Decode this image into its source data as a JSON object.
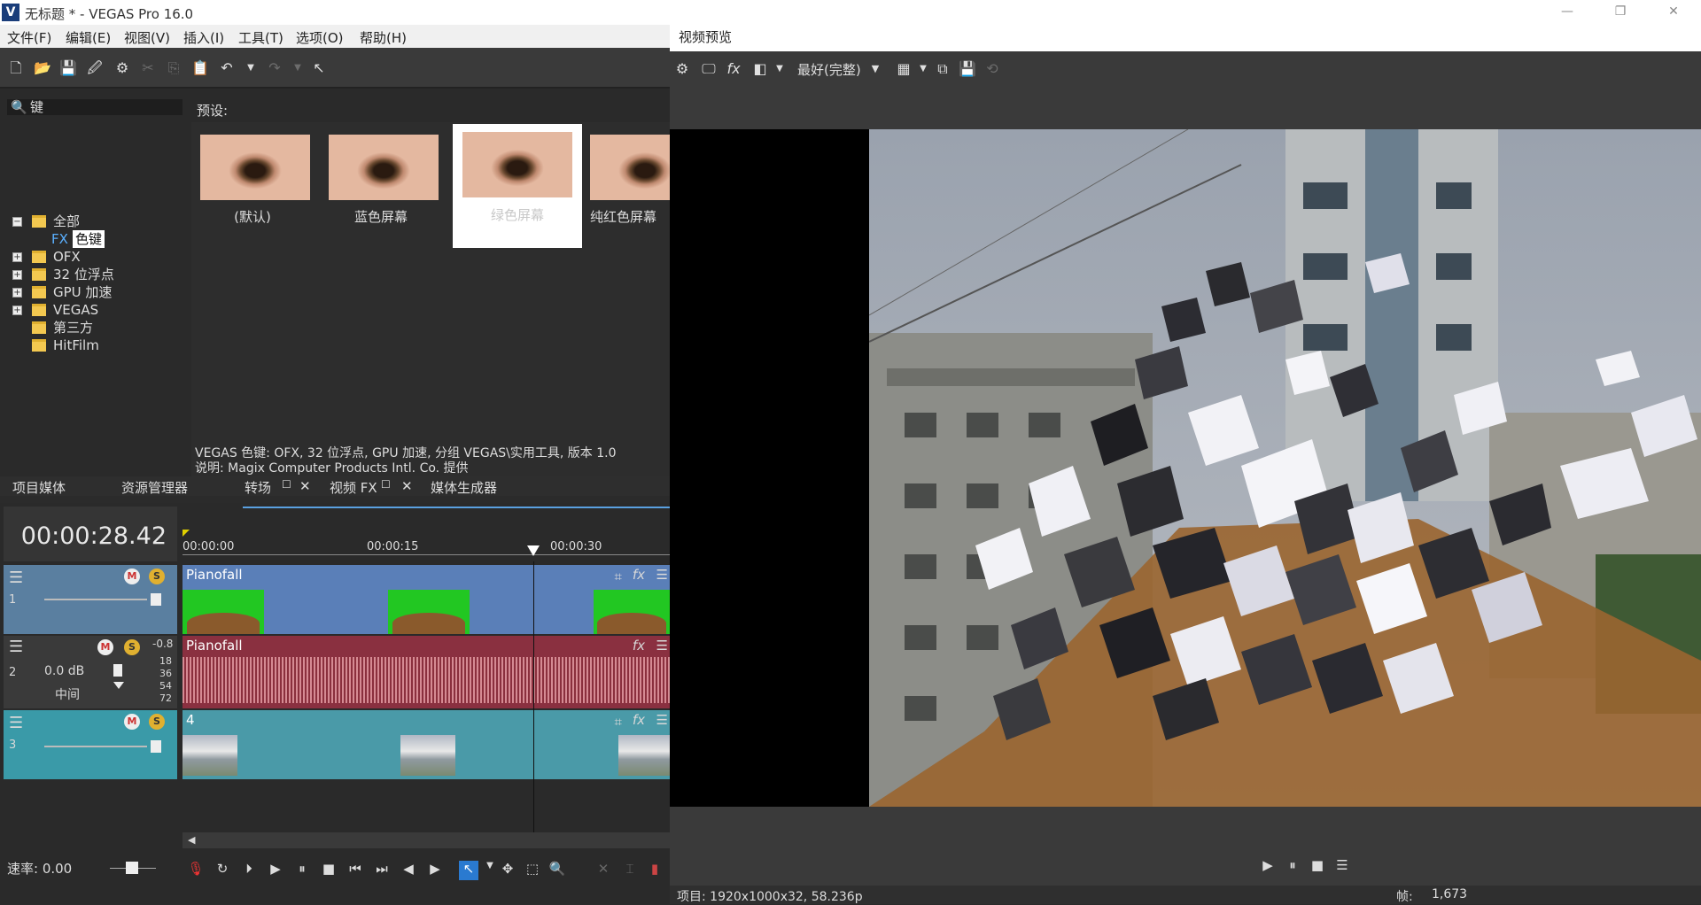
{
  "window": {
    "title": "无标题 * - VEGAS Pro 16.0",
    "controls": [
      "—",
      "❐",
      "✕"
    ]
  },
  "menu": [
    "文件(F)",
    "编辑(E)",
    "视图(V)",
    "插入(I)",
    "工具(T)",
    "选项(O)",
    "帮助(H)"
  ],
  "explorer": {
    "search_value": "键",
    "tree": [
      {
        "label": "全部",
        "expanded": true
      },
      {
        "label": "色键",
        "prefix": "FX",
        "selected": true
      },
      {
        "label": "OFX"
      },
      {
        "label": "32 位浮点"
      },
      {
        "label": "GPU 加速"
      },
      {
        "label": "VEGAS"
      },
      {
        "label": "第三方"
      },
      {
        "label": "HitFilm"
      }
    ],
    "presets_label": "预设:",
    "presets": [
      "(默认)",
      "蓝色屏幕",
      "绿色屏幕",
      "纯红色屏幕"
    ],
    "description_line1": "VEGAS 色键: OFX, 32 位浮点, GPU 加速, 分组 VEGAS\\实用工具, 版本 1.0",
    "description_line2": "说明: Magix Computer Products Intl. Co. 提供"
  },
  "dock_tabs": [
    "项目媒体",
    "资源管理器",
    "转场",
    "视频 FX",
    "媒体生成器"
  ],
  "timeline": {
    "timecode": "00:00:28.42",
    "ticks": [
      "00:00:00",
      "00:00:15",
      "00:00:30"
    ],
    "tracks": [
      {
        "num": "1",
        "clip": "Pianofall",
        "color": "#5a7ab0"
      },
      {
        "num": "2",
        "clip": "Pianofall",
        "color": "#8a3040",
        "volume": "0.0 dB",
        "pan": "中间",
        "level": "-0.8",
        "meter": [
          "18",
          "36",
          "54",
          "72"
        ]
      },
      {
        "num": "3",
        "clip": "4",
        "color": "#4a9aa8"
      }
    ],
    "rate": "速率: 0.00"
  },
  "preview": {
    "title": "视频预览",
    "quality": "最好(完整)",
    "status_left": "项目: 1920x1000x32, 58.236p",
    "status_right_label": "帧:",
    "status_right_value": "1,673"
  }
}
